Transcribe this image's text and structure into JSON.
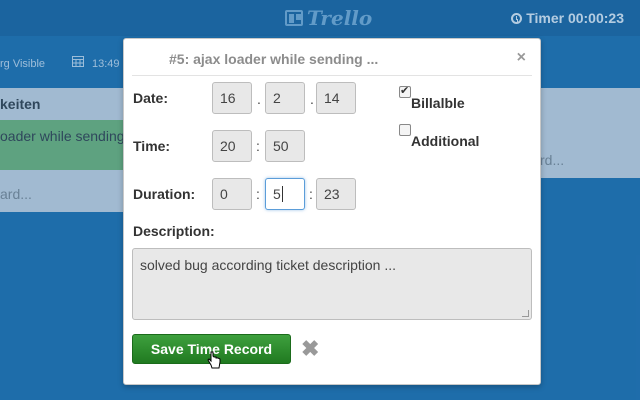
{
  "header": {
    "logo_text": "Trello",
    "timer_label": "Timer 00:00:23"
  },
  "boardbar": {
    "visibility_text": "rg Visible",
    "time_text": "13:49"
  },
  "background_lists": {
    "left_title": "keiten",
    "left_card": "oader while sending",
    "left_add": "ard...",
    "right_add": "rd..."
  },
  "modal": {
    "title": "#5: ajax loader while sending ...",
    "close": "×",
    "date": {
      "label": "Date:",
      "day": "16",
      "month": "2",
      "year": "14",
      "sep": "."
    },
    "time": {
      "label": "Time:",
      "hour": "20",
      "minute": "50",
      "sep": ":"
    },
    "duration": {
      "label": "Duration:",
      "hours": "0",
      "minutes": "5",
      "seconds": "23",
      "sep": ":"
    },
    "billable": {
      "label": "Billalble",
      "checked": true
    },
    "additional": {
      "label": "Additional",
      "checked": false
    },
    "description": {
      "label": "Description:",
      "value": "solved bug according ticket description ..."
    },
    "save_button": "Save Time Record",
    "cancel": "✖"
  },
  "colors": {
    "board_bg": "#1a6dab",
    "save_green": "#2b8a2b"
  }
}
